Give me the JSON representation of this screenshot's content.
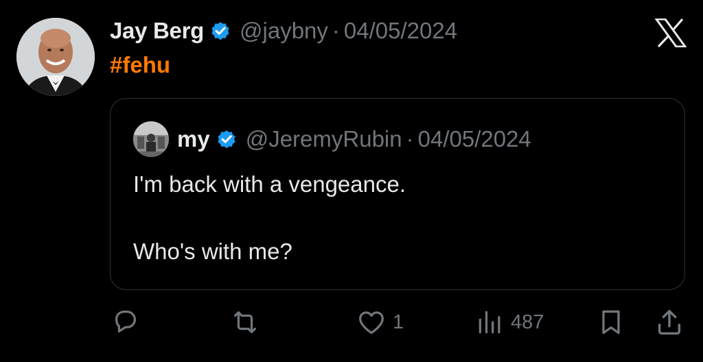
{
  "tweet": {
    "author_name": "Jay Berg",
    "handle": "@jaybny",
    "separator": "·",
    "date": "04/05/2024",
    "hashtag": "#fehu",
    "verified_icon": "verified-badge-icon",
    "platform_logo": "x-logo-icon"
  },
  "quoted": {
    "author_name": "my",
    "handle": "@JeremyRubin",
    "separator": "·",
    "date": "04/05/2024",
    "text_line1": "I'm back with a vengeance.",
    "text_line2": "Who's with me?"
  },
  "actions": {
    "reply_icon": "reply-icon",
    "repost_icon": "repost-icon",
    "like_icon": "like-icon",
    "like_count": "1",
    "views_icon": "views-icon",
    "views_count": "487",
    "bookmark_icon": "bookmark-icon",
    "share_icon": "share-icon"
  },
  "colors": {
    "background": "#000000",
    "text": "#e7e9ea",
    "secondary": "#71767b",
    "hashtag": "#ff7a00",
    "verified": "#1d9bf0",
    "border": "#2f3336"
  }
}
